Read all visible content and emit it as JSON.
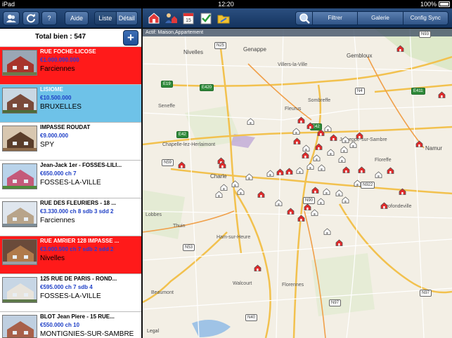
{
  "status": {
    "carrier": "iPad",
    "time": "12:20",
    "battery": "100%"
  },
  "toolbar": {
    "aide": "Aide",
    "help": "?",
    "view_list": "Liste",
    "view_detail": "Détail"
  },
  "map_toolbar": {
    "filter": "Filtrer",
    "gallery": "Galerie",
    "sync": "Config Sync"
  },
  "list": {
    "total": "Total bien : 547",
    "add_label": "+",
    "items": [
      {
        "title": "RUE FOCHE-LICOSE",
        "price": "€1.000.000.000",
        "city": "Farciennes",
        "state": "red"
      },
      {
        "title": "LISIOME",
        "price": "€10.500.000",
        "city": "BRUXELLES",
        "state": "blue"
      },
      {
        "title": "IMPASSE ROUDAT",
        "price": "€9.000.000",
        "city": "SPY",
        "state": "normal"
      },
      {
        "title": "Jean-Jack 1er - FOSSES-LILI...",
        "price": "€650.000 ch 7",
        "city": "FOSSES-LA-VILLE",
        "state": "normal"
      },
      {
        "title": "RUE DES FLEURIERS - 18 ...",
        "price": "€3.330.000 ch 8 sdb 3 sdd 2",
        "city": "Farciennes",
        "state": "normal"
      },
      {
        "title": "RUE AMRIER 128 IMPASSE ...",
        "price": "€3.000.500 ch 7 sdb 2 sdd 2",
        "city": "Nivelles",
        "state": "red"
      },
      {
        "title": "125 RUE DE PARIS - ROND...",
        "price": "€595.000 ch 7 sdb 4",
        "city": "FOSSES-LA-VILLE",
        "state": "normal"
      },
      {
        "title": "BLOT Jean Piere - 15 RUE...",
        "price": "€550.000 ch 10",
        "city": "MONTIGNIES-SUR-SAMBRE",
        "state": "normal"
      }
    ]
  },
  "map": {
    "caption": "Actif: Maison,Appartement",
    "legal": "Legal",
    "places": {
      "nivelles": "Nivelles",
      "genappe": "Genappe",
      "villers": "Villers-la-Ville",
      "gembloux": "Gembloux",
      "seneffe": "Seneffe",
      "sombreffe": "Sombreffe",
      "fleurus": "Fleurus",
      "jemeppe": "Jemeppe-sur-Sambre",
      "namur": "Namur",
      "chapelle": "Chapelle-lez-Herlaimont",
      "charleroi": "Charle",
      "floreffe": "Floreffe",
      "profondeville": "Profondeville",
      "lobbes": "Lobbes",
      "thuin": "Thuin",
      "hamsurheure": "Ham-sur-Heure",
      "beaumont": "Beaumont",
      "walcourt": "Walcourt",
      "florennes": "Florennes"
    },
    "roads": {
      "n25": "N25",
      "e19": "E19",
      "e420": "E420",
      "n4": "N4",
      "e411": "E411",
      "n93": "N93",
      "e42a": "E42",
      "e42b": "E42",
      "n59": "N59",
      "n922": "N922",
      "n90": "N90",
      "n53": "N53",
      "n40": "N40",
      "n97a": "N97",
      "n97b": "N97"
    }
  }
}
